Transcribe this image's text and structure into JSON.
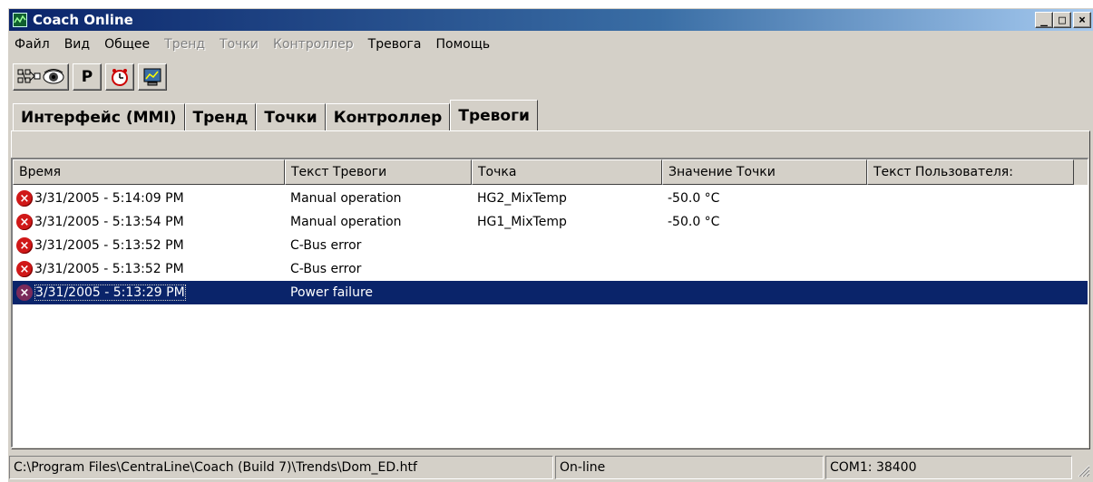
{
  "window": {
    "title": "Coach Online",
    "minimize_label": "_",
    "maximize_label": "□",
    "close_label": "×"
  },
  "menu": [
    {
      "label": "Файл",
      "enabled": true
    },
    {
      "label": "Вид",
      "enabled": true
    },
    {
      "label": "Общее",
      "enabled": true
    },
    {
      "label": "Тренд",
      "enabled": false
    },
    {
      "label": "Точки",
      "enabled": false
    },
    {
      "label": "Контроллер",
      "enabled": false
    },
    {
      "label": "Тревога",
      "enabled": true
    },
    {
      "label": "Помощь",
      "enabled": true
    }
  ],
  "toolbar": {
    "p_label": "P",
    "buttons": [
      "points-view-icon",
      "eye-icon",
      "p-button",
      "alarm-clock-icon",
      "monitor-icon"
    ]
  },
  "tabs": [
    {
      "label": "Интерфейс (MMI)",
      "active": false
    },
    {
      "label": "Тренд",
      "active": false
    },
    {
      "label": "Точки",
      "active": false
    },
    {
      "label": "Контроллер",
      "active": false
    },
    {
      "label": "Тревоги",
      "active": true
    }
  ],
  "alarms": {
    "columns": [
      "Время",
      "Текст Тревоги",
      "Точка",
      "Значение Точки",
      "Текст Пользователя:"
    ],
    "rows": [
      {
        "time": "3/31/2005 - 5:14:09 PM",
        "text": "Manual operation",
        "point": "HG2_MixTemp",
        "value": "-50.0 °C",
        "user_text": "",
        "selected": false
      },
      {
        "time": "3/31/2005 - 5:13:54 PM",
        "text": "Manual operation",
        "point": "HG1_MixTemp",
        "value": "-50.0 °C",
        "user_text": "",
        "selected": false
      },
      {
        "time": "3/31/2005 - 5:13:52 PM",
        "text": "C-Bus error",
        "point": "",
        "value": "",
        "user_text": "",
        "selected": false
      },
      {
        "time": "3/31/2005 - 5:13:52 PM",
        "text": "C-Bus error",
        "point": "",
        "value": "",
        "user_text": "",
        "selected": false
      },
      {
        "time": "3/31/2005 - 5:13:29 PM",
        "text": "Power failure",
        "point": "",
        "value": "",
        "user_text": "",
        "selected": true
      }
    ],
    "icon_glyph": "×"
  },
  "statusbar": {
    "path": "C:\\Program Files\\CentraLine\\Coach (Build 7)\\Trends\\Dom_ED.htf",
    "connection": "On-line",
    "port": "COM1: 38400"
  }
}
